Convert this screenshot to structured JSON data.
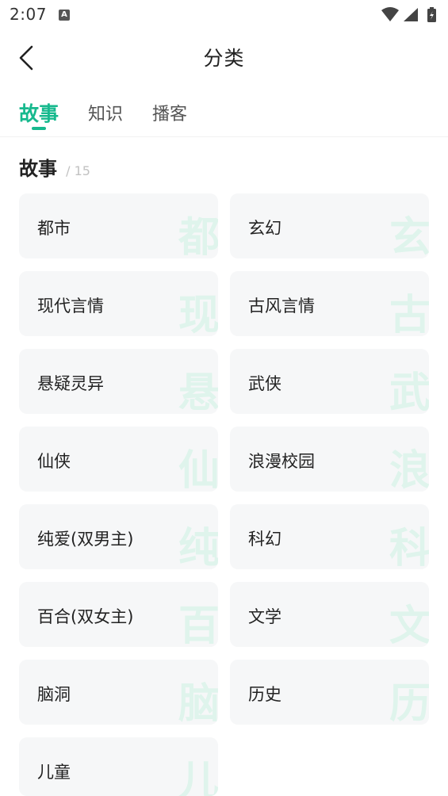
{
  "status_bar": {
    "time": "2:07",
    "notification_icon": "A"
  },
  "header": {
    "title": "分类",
    "back_icon": "chevron-left-icon"
  },
  "tabs": [
    {
      "label": "故事",
      "active": true
    },
    {
      "label": "知识",
      "active": false
    },
    {
      "label": "播客",
      "active": false
    }
  ],
  "section": {
    "title": "故事",
    "count": "/ 15"
  },
  "categories": [
    {
      "label": "都市",
      "watermark": "都"
    },
    {
      "label": "玄幻",
      "watermark": "玄"
    },
    {
      "label": "现代言情",
      "watermark": "现"
    },
    {
      "label": "古风言情",
      "watermark": "古"
    },
    {
      "label": "悬疑灵异",
      "watermark": "悬"
    },
    {
      "label": "武侠",
      "watermark": "武"
    },
    {
      "label": "仙侠",
      "watermark": "仙"
    },
    {
      "label": "浪漫校园",
      "watermark": "浪"
    },
    {
      "label": "纯爱(双男主)",
      "watermark": "纯"
    },
    {
      "label": "科幻",
      "watermark": "科"
    },
    {
      "label": "百合(双女主)",
      "watermark": "百"
    },
    {
      "label": "文学",
      "watermark": "文"
    },
    {
      "label": "脑洞",
      "watermark": "脑"
    },
    {
      "label": "历史",
      "watermark": "历"
    },
    {
      "label": "儿童",
      "watermark": "儿"
    }
  ],
  "colors": {
    "accent": "#17b98e",
    "card_bg": "#f6f7f8",
    "watermark": "#dff4ec"
  }
}
